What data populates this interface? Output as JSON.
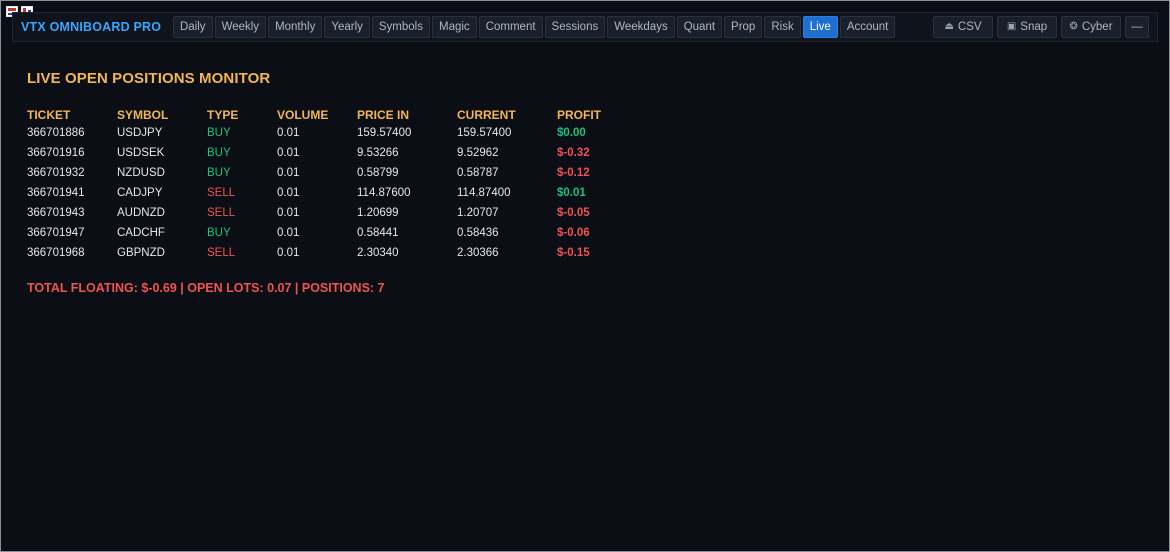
{
  "app": {
    "title": "VTX OMNIBOARD PRO"
  },
  "tabs": [
    {
      "label": "Daily"
    },
    {
      "label": "Weekly"
    },
    {
      "label": "Monthly"
    },
    {
      "label": "Yearly"
    },
    {
      "label": "Symbols"
    },
    {
      "label": "Magic"
    },
    {
      "label": "Comment"
    },
    {
      "label": "Sessions"
    },
    {
      "label": "Weekdays"
    },
    {
      "label": "Quant"
    },
    {
      "label": "Prop"
    },
    {
      "label": "Risk"
    },
    {
      "label": "Live",
      "active": true
    },
    {
      "label": "Account"
    }
  ],
  "tools": {
    "csv": "CSV",
    "snap": "Snap",
    "cyber": "Cyber",
    "minimize": "—"
  },
  "icons": {
    "csv": "export-icon",
    "snap": "camera-icon",
    "cyber": "palette-icon"
  },
  "colors": {
    "brand": "#35a7ff",
    "heading": "#f3b652",
    "buy": "#19c37d",
    "sell": "#f05353",
    "activeTab": "#1f6fd1"
  },
  "panel": {
    "title": "LIVE OPEN POSITIONS MONITOR"
  },
  "table": {
    "headers": {
      "ticket": "TICKET",
      "symbol": "SYMBOL",
      "type": "TYPE",
      "volume": "VOLUME",
      "price_in": "PRICE IN",
      "current": "CURRENT",
      "profit": "PROFIT"
    },
    "rows": [
      {
        "ticket": "366701886",
        "symbol": "USDJPY",
        "type": "BUY",
        "volume": "0.01",
        "price_in": "159.57400",
        "current": "159.57400",
        "profit": "$0.00",
        "sign": "pos"
      },
      {
        "ticket": "366701916",
        "symbol": "USDSEK",
        "type": "BUY",
        "volume": "0.01",
        "price_in": "9.53266",
        "current": "9.52962",
        "profit": "$-0.32",
        "sign": "neg"
      },
      {
        "ticket": "366701932",
        "symbol": "NZDUSD",
        "type": "BUY",
        "volume": "0.01",
        "price_in": "0.58799",
        "current": "0.58787",
        "profit": "$-0.12",
        "sign": "neg"
      },
      {
        "ticket": "366701941",
        "symbol": "CADJPY",
        "type": "SELL",
        "volume": "0.01",
        "price_in": "114.87600",
        "current": "114.87400",
        "profit": "$0.01",
        "sign": "pos"
      },
      {
        "ticket": "366701943",
        "symbol": "AUDNZD",
        "type": "SELL",
        "volume": "0.01",
        "price_in": "1.20699",
        "current": "1.20707",
        "profit": "$-0.05",
        "sign": "neg"
      },
      {
        "ticket": "366701947",
        "symbol": "CADCHF",
        "type": "BUY",
        "volume": "0.01",
        "price_in": "0.58441",
        "current": "0.58436",
        "profit": "$-0.06",
        "sign": "neg"
      },
      {
        "ticket": "366701968",
        "symbol": "GBPNZD",
        "type": "SELL",
        "volume": "0.01",
        "price_in": "2.30340",
        "current": "2.30366",
        "profit": "$-0.15",
        "sign": "neg"
      }
    ]
  },
  "summary": {
    "text": "TOTAL FLOATING: $-0.69 | OPEN LOTS: 0.07 | POSITIONS: 7"
  }
}
